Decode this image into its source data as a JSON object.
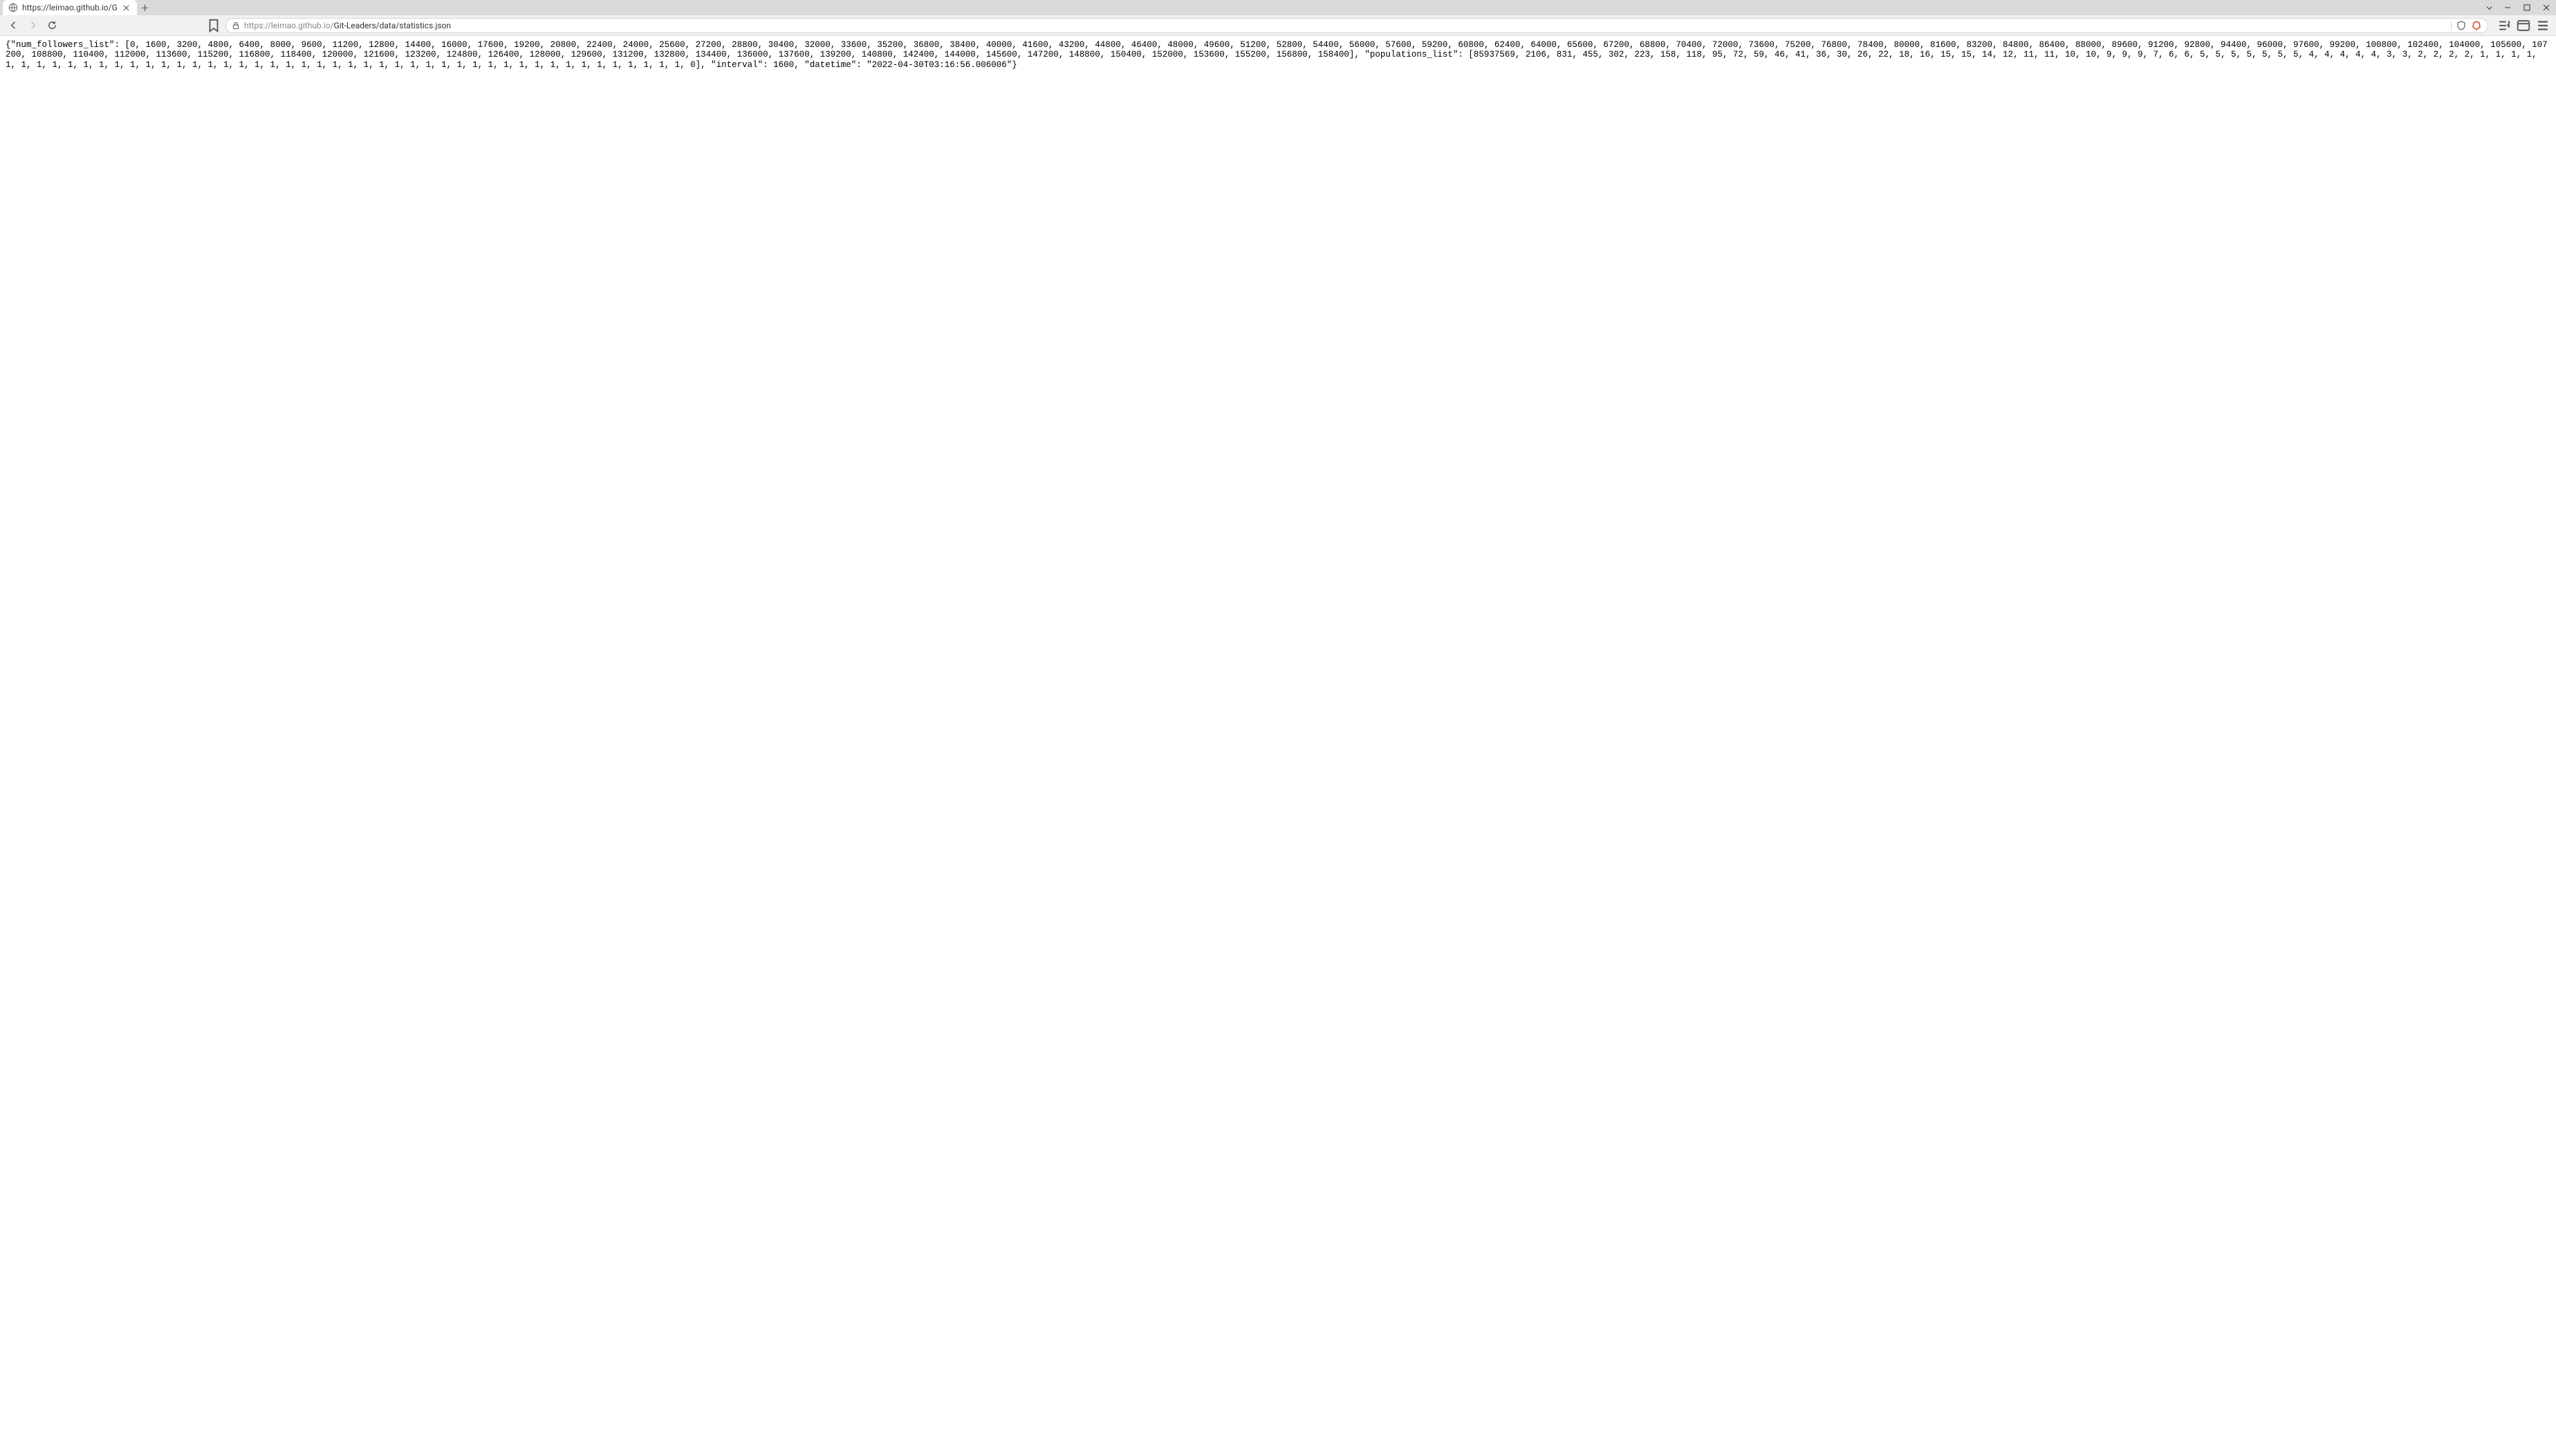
{
  "tab": {
    "title": "https://leimao.github.io/G"
  },
  "address": {
    "host": "https://leimao.github.io/",
    "path": "Git-Leaders/data/statistics.json"
  },
  "content": {
    "json_text": "{\"num_followers_list\": [0, 1600, 3200, 4800, 6400, 8000, 9600, 11200, 12800, 14400, 16000, 17600, 19200, 20800, 22400, 24000, 25600, 27200, 28800, 30400, 32000, 33600, 35200, 36800, 38400, 40000, 41600, 43200, 44800, 46400, 48000, 49600, 51200, 52800, 54400, 56000, 57600, 59200, 60800, 62400, 64000, 65600, 67200, 68800, 70400, 72000, 73600, 75200, 76800, 78400, 80000, 81600, 83200, 84800, 86400, 88000, 89600, 91200, 92800, 94400, 96000, 97600, 99200, 100800, 102400, 104000, 105600, 107200, 108800, 110400, 112000, 113600, 115200, 116800, 118400, 120000, 121600, 123200, 124800, 126400, 128000, 129600, 131200, 132800, 134400, 136000, 137600, 139200, 140800, 142400, 144000, 145600, 147200, 148800, 150400, 152000, 153600, 155200, 156800, 158400], \"populations_list\": [85937569, 2106, 831, 455, 302, 223, 158, 118, 95, 72, 59, 46, 41, 36, 30, 26, 22, 18, 16, 15, 15, 14, 12, 11, 11, 10, 10, 9, 9, 9, 7, 6, 6, 5, 5, 5, 5, 5, 5, 5, 4, 4, 4, 4, 4, 3, 3, 2, 2, 2, 2, 1, 1, 1, 1, 1, 1, 1, 1, 1, 1, 1, 1, 1, 1, 1, 1, 1, 1, 1, 1, 1, 1, 1, 1, 1, 1, 1, 1, 1, 1, 1, 1, 1, 1, 1, 1, 1, 1, 1, 1, 1, 1, 1, 1, 1, 1, 1, 1, 0], \"interval\": 1600, \"datetime\": \"2022-04-30T03:16:56.006006\"}"
  }
}
